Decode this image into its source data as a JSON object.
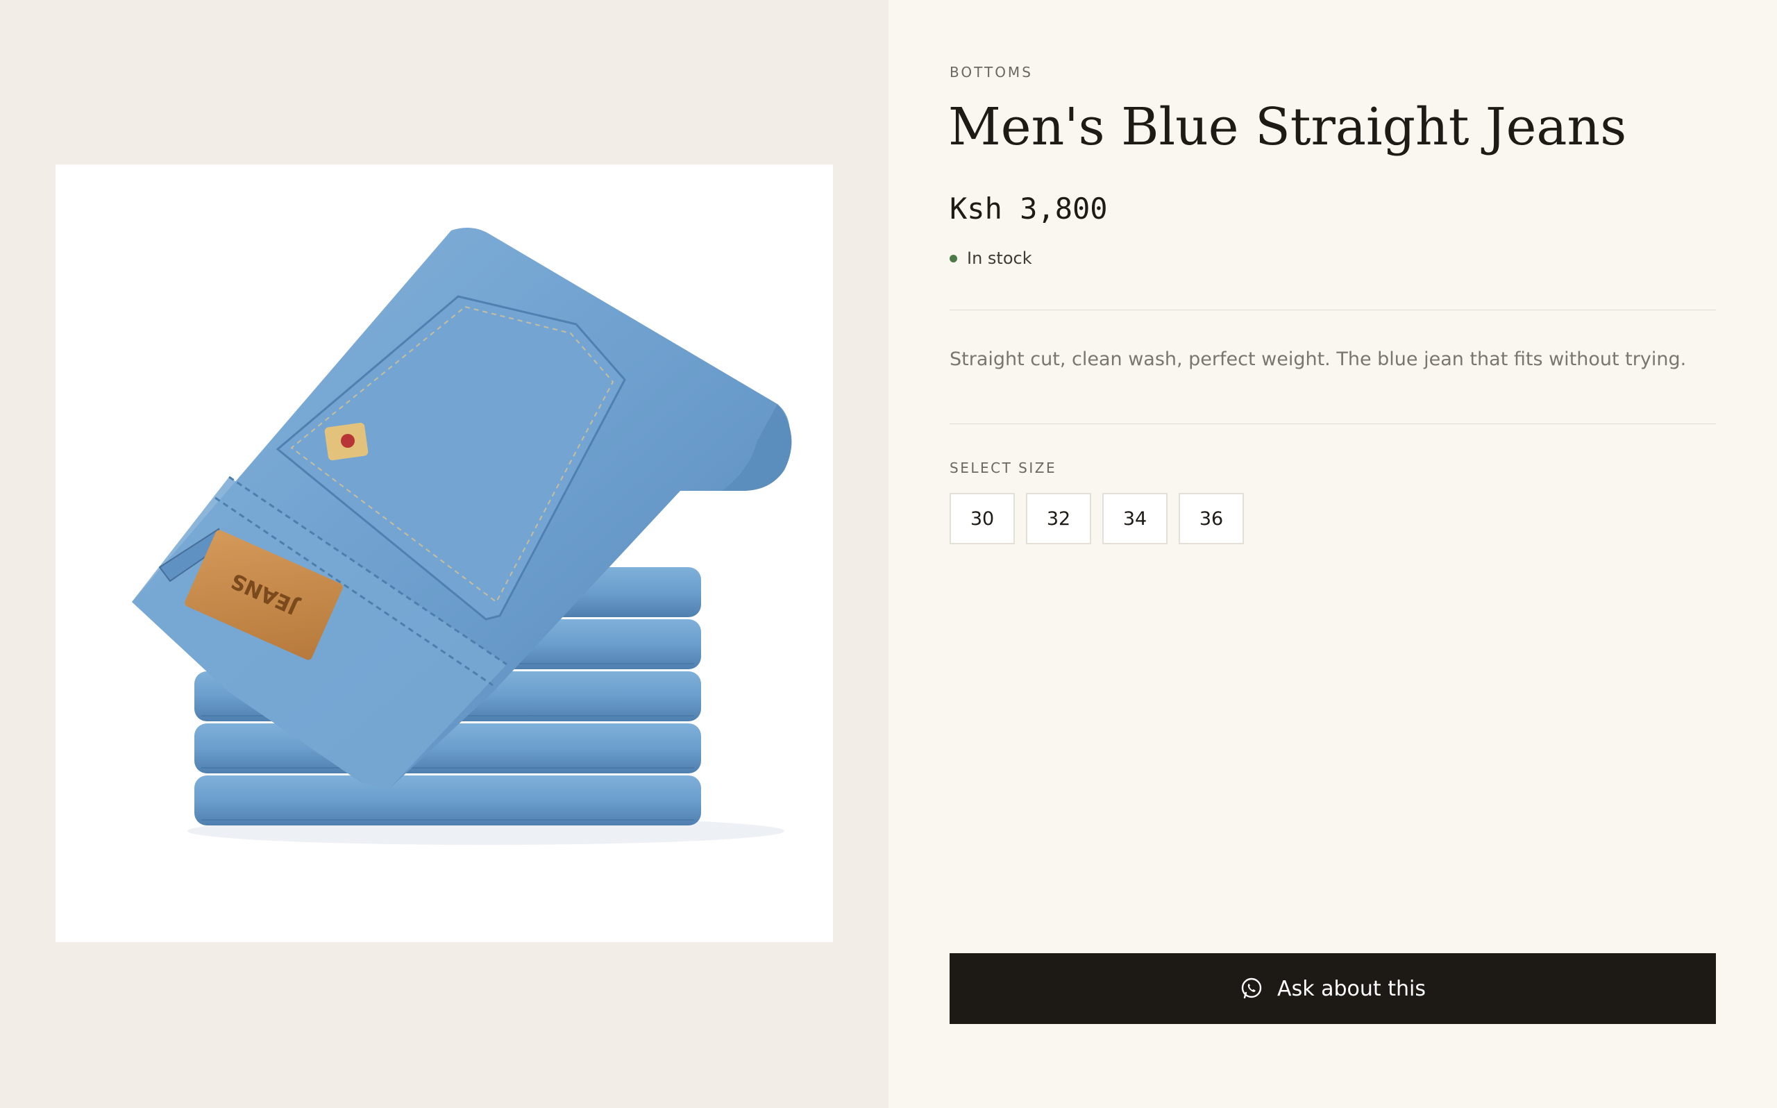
{
  "product": {
    "category": "BOTTOMS",
    "title": "Men's Blue Straight Jeans",
    "price": "Ksh 3,800",
    "stock_status": "In stock",
    "description": "Straight cut, clean wash, perfect weight. The blue jean that fits without trying.",
    "image_alt": "Stack of folded light blue denim jeans with leather patch",
    "patch_text": "JEANS"
  },
  "size_selector": {
    "label": "SELECT SIZE",
    "options": [
      "30",
      "32",
      "34",
      "36"
    ]
  },
  "cta": {
    "label": "Ask about this",
    "icon": "whatsapp-icon"
  },
  "colors": {
    "left_bg": "#f2ede7",
    "right_bg": "#faf7f1",
    "cta_bg": "#1d1a16",
    "stock_dot": "#4c7a46",
    "denim": "#6a9ccb"
  }
}
